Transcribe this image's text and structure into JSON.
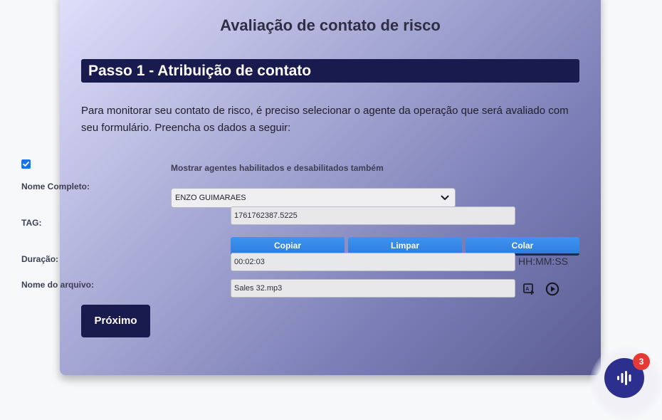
{
  "page": {
    "title": "Avaliação de contato de risco",
    "step_title": "Passo 1 - Atribuição de contato",
    "intro": "Para monitorar seu contato de risco, é preciso selecionar o agente da operação que será avaliado com seu formulário. Preencha os dados a seguir:"
  },
  "form": {
    "show_all_checked": true,
    "show_all_label": "Mostrar agentes habilitados e desabilitados também",
    "name_label": "Nome Completo:",
    "name_value": "ENZO GUIMARAES",
    "tag_label": "TAG:",
    "tag_value": "1761762387.5225",
    "buttons": {
      "copy": "Copiar",
      "clear": "Limpar",
      "paste": "Colar"
    },
    "duration_label": "Duração:",
    "duration_value": "00:02:03",
    "duration_unit": "HH:MM:SS",
    "file_label": "Nome do arquivo:",
    "file_value": "Sales 32.mp3",
    "file_icons": [
      "transcript-icon",
      "play-icon"
    ],
    "next_button": "Próximo"
  },
  "widget": {
    "icon": "voice-assistant-icon",
    "badge_count": "3",
    "badge_color": "#e53935",
    "accent_color": "#2d2f8f"
  },
  "colors": {
    "banner": "#191a4e",
    "button_blue": "#3e95f0"
  }
}
